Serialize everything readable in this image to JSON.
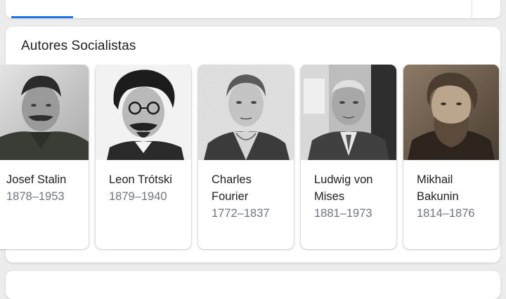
{
  "section": {
    "title": "Autores Socialistas"
  },
  "people": [
    {
      "name": "Josef Stalin",
      "years": "1878–1953"
    },
    {
      "name": "Leon Trótski",
      "years": "1879–1940"
    },
    {
      "name": "Charles Fourier",
      "years": "1772–1837"
    },
    {
      "name": "Ludwig von Mises",
      "years": "1881–1973"
    },
    {
      "name": "Mikhail Bakunin",
      "years": "1814–1876"
    }
  ],
  "colors": {
    "accent": "#1a73e8",
    "primary_text": "#202124",
    "secondary_text": "#70757a",
    "page_background": "#ececec"
  }
}
